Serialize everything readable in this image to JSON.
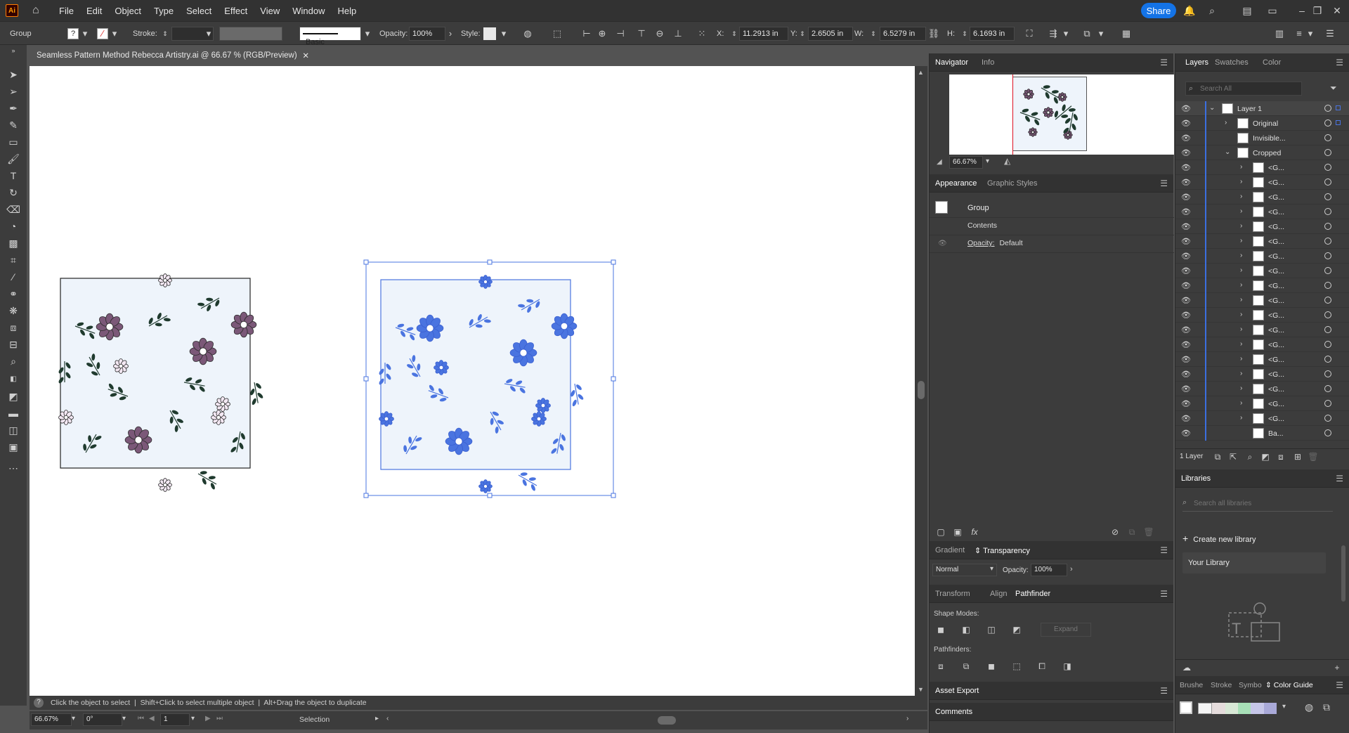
{
  "app": {
    "logo": "Ai",
    "share_label": "Share"
  },
  "menu": [
    "File",
    "Edit",
    "Object",
    "Type",
    "Select",
    "Effect",
    "View",
    "Window",
    "Help"
  ],
  "control": {
    "selection_type": "Group",
    "stroke_label": "Stroke:",
    "brush_label": "Basic",
    "opacity_label": "Opacity:",
    "opacity_value": "100%",
    "style_label": "Style:",
    "x_label": "X:",
    "x_value": "11.2913 in",
    "y_label": "Y:",
    "y_value": "2.6505 in",
    "w_label": "W:",
    "w_value": "6.5279 in",
    "h_label": "H:",
    "h_value": "6.1693 in"
  },
  "document": {
    "tab_title": "Seamless Pattern Method Rebecca Artistry.ai @ 66.67 % (RGB/Preview)"
  },
  "status": {
    "hint": "Click the object to select  |  Shift+Click to select multiple object  |  Alt+Drag the object to duplicate",
    "zoom": "66.67%",
    "rotation": "0°",
    "artboard": "1",
    "tool": "Selection"
  },
  "navigator": {
    "tab_active": "Navigator",
    "tab_other": "Info",
    "zoom": "66.67%"
  },
  "appearance": {
    "tab_active": "Appearance",
    "tab_other": "Graphic Styles",
    "object": "Group",
    "contents": "Contents",
    "opacity_label": "Opacity:",
    "opacity_value": "Default"
  },
  "transparency": {
    "tab_other": "Gradient",
    "tab_active": "Transparency",
    "blend_mode": "Normal",
    "opacity_label": "Opacity:",
    "opacity_value": "100%"
  },
  "pathfinder": {
    "tabs": [
      "Transform",
      "Align",
      "Pathfinder"
    ],
    "shape_modes_label": "Shape Modes:",
    "expand_label": "Expand",
    "pathfinders_label": "Pathfinders:"
  },
  "asset_export": "Asset Export",
  "comments": "Comments",
  "layers_panel": {
    "tabs": [
      "Layers",
      "Swatches",
      "Color"
    ],
    "search_placeholder": "Search All",
    "layers": [
      {
        "name": "Layer 1",
        "indent": 0,
        "chevron": "v"
      },
      {
        "name": "Original",
        "indent": 1,
        "chevron": ">"
      },
      {
        "name": "Invisible...",
        "indent": 1,
        "chevron": ""
      },
      {
        "name": "Cropped",
        "indent": 1,
        "chevron": "v"
      },
      {
        "name": "<G...",
        "indent": 2,
        "chevron": ">"
      },
      {
        "name": "<G...",
        "indent": 2,
        "chevron": ">"
      },
      {
        "name": "<G...",
        "indent": 2,
        "chevron": ">"
      },
      {
        "name": "<G...",
        "indent": 2,
        "chevron": ">"
      },
      {
        "name": "<G...",
        "indent": 2,
        "chevron": ">"
      },
      {
        "name": "<G...",
        "indent": 2,
        "chevron": ">"
      },
      {
        "name": "<G...",
        "indent": 2,
        "chevron": ">"
      },
      {
        "name": "<G...",
        "indent": 2,
        "chevron": ">"
      },
      {
        "name": "<G...",
        "indent": 2,
        "chevron": ">"
      },
      {
        "name": "<G...",
        "indent": 2,
        "chevron": ">"
      },
      {
        "name": "<G...",
        "indent": 2,
        "chevron": ">"
      },
      {
        "name": "<G...",
        "indent": 2,
        "chevron": ">"
      },
      {
        "name": "<G...",
        "indent": 2,
        "chevron": ">"
      },
      {
        "name": "<G...",
        "indent": 2,
        "chevron": ">"
      },
      {
        "name": "<G...",
        "indent": 2,
        "chevron": ">"
      },
      {
        "name": "<G...",
        "indent": 2,
        "chevron": ">"
      },
      {
        "name": "<G...",
        "indent": 2,
        "chevron": ">"
      },
      {
        "name": "<G...",
        "indent": 2,
        "chevron": ">"
      },
      {
        "name": "Ba...",
        "indent": 2,
        "chevron": ""
      }
    ],
    "footer_count": "1 Layer"
  },
  "libraries": {
    "title": "Libraries",
    "search_placeholder": "Search all libraries",
    "create_label": "Create new library",
    "your_library": "Your Library"
  },
  "bottom_tabs": [
    "Brushe",
    "Stroke",
    "Symbo",
    "Color Guide"
  ],
  "colors": {
    "accent": "#1473e6",
    "selection": "#4a74e0",
    "flower_purple": "#7b5878",
    "leaf_dark": "#1f3a2e"
  }
}
